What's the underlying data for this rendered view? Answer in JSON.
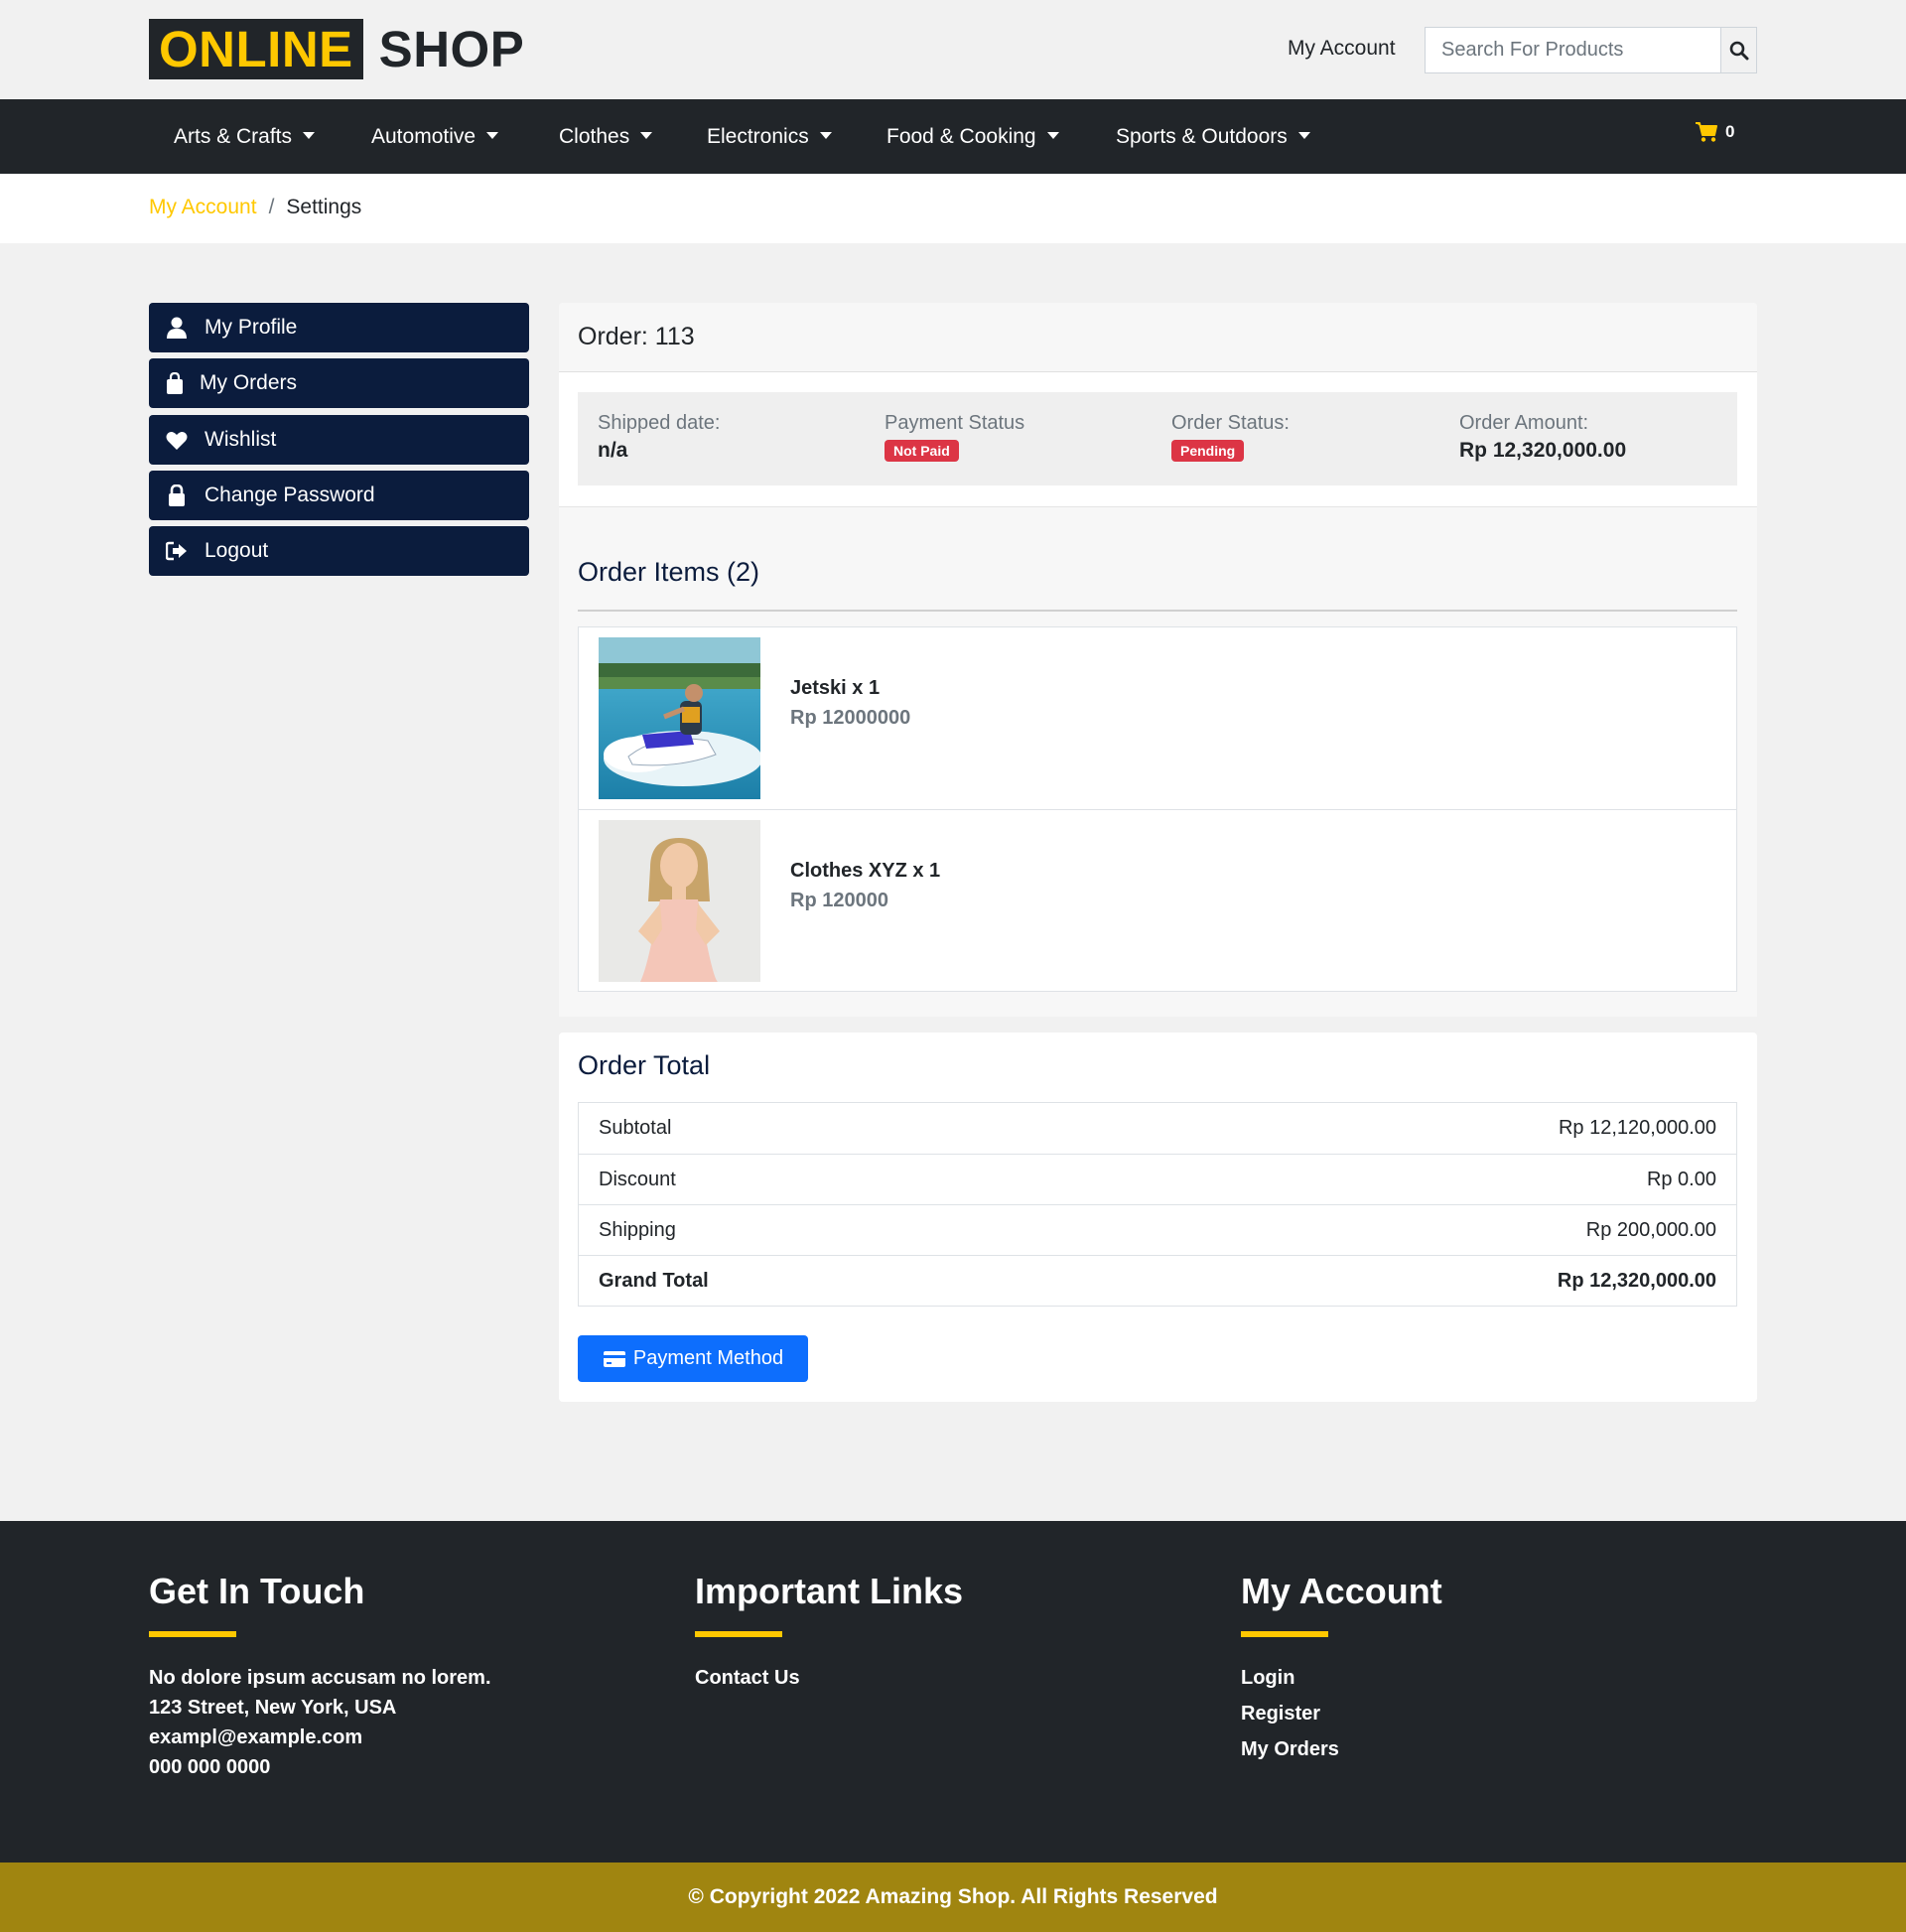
{
  "header": {
    "logo_primary": "ONLINE",
    "logo_secondary": "SHOP",
    "account_link": "My Account",
    "search_placeholder": "Search For Products",
    "cart_count": "0"
  },
  "nav": {
    "items": [
      {
        "label": "Arts & Crafts"
      },
      {
        "label": "Automotive"
      },
      {
        "label": "Clothes"
      },
      {
        "label": "Electronics"
      },
      {
        "label": "Food & Cooking"
      },
      {
        "label": "Sports & Outdoors"
      }
    ]
  },
  "breadcrumb": {
    "parent": "My Account",
    "separator": "/",
    "current": "Settings"
  },
  "sidebar": {
    "items": [
      {
        "label": "My Profile",
        "icon": "user-icon"
      },
      {
        "label": "My Orders",
        "icon": "shopping-bag-icon"
      },
      {
        "label": "Wishlist",
        "icon": "heart-icon"
      },
      {
        "label": "Change Password",
        "icon": "lock-icon"
      },
      {
        "label": "Logout",
        "icon": "logout-icon"
      }
    ]
  },
  "order": {
    "title": "Order: 113",
    "shipped_label": "Shipped date:",
    "shipped_value": "n/a",
    "payment_label": "Payment Status",
    "payment_badge": "Not Paid",
    "status_label": "Order Status:",
    "status_badge": "Pending",
    "amount_label": "Order Amount:",
    "amount_value": "Rp 12,320,000.00",
    "items_title": "Order Items (2)",
    "items": [
      {
        "name": "Jetski x 1",
        "price": "Rp 12000000",
        "image": "jetski-photo"
      },
      {
        "name": "Clothes XYZ x 1",
        "price": "Rp 120000",
        "image": "girl-in-dress-photo"
      }
    ]
  },
  "totals": {
    "title": "Order Total",
    "rows": [
      {
        "label": "Subtotal",
        "value": "Rp 12,120,000.00"
      },
      {
        "label": "Discount",
        "value": "Rp 0.00"
      },
      {
        "label": "Shipping",
        "value": "Rp 200,000.00"
      },
      {
        "label": "Grand Total",
        "value": "Rp 12,320,000.00"
      }
    ],
    "pay_button": "Payment Method"
  },
  "footer": {
    "touch_title": "Get In Touch",
    "touch_lines": [
      "No dolore ipsum accusam no lorem.",
      "123 Street, New York, USA",
      "exampl@example.com",
      "000 000 0000"
    ],
    "links_title": "Important Links",
    "links": [
      "Contact Us"
    ],
    "account_title": "My Account",
    "account_links": [
      "Login",
      "Register",
      "My Orders"
    ],
    "copyright": "© Copyright 2022 Amazing Shop. All Rights Reserved"
  },
  "colors": {
    "accent": "#ffc800",
    "dark": "#212529",
    "sidebar_bg": "#0b1c3d",
    "badge_red": "#dc3545",
    "primary_button": "#0d6efd",
    "copyright_bg": "#a08510"
  }
}
